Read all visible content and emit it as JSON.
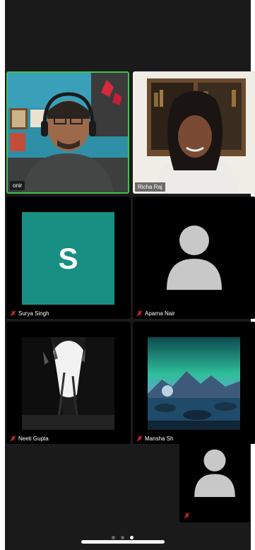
{
  "participants": [
    {
      "name": "onir",
      "muted": false,
      "active": true
    },
    {
      "name": "Richa Raj",
      "muted": false,
      "active": false
    },
    {
      "name": "Surya Singh",
      "muted": true,
      "avatar_letter": "S"
    },
    {
      "name": "Aparna Nair",
      "muted": true
    },
    {
      "name": "Neeti Gupta",
      "muted": true
    },
    {
      "name": "Mansha Sh",
      "muted": true
    }
  ],
  "self_view": {
    "muted": true
  },
  "pager": {
    "pages": 3,
    "current": 3
  },
  "colors": {
    "active_border": "#3fc24a",
    "avatar_bg": "#178f82",
    "muted_mic": "#e02b2b"
  }
}
